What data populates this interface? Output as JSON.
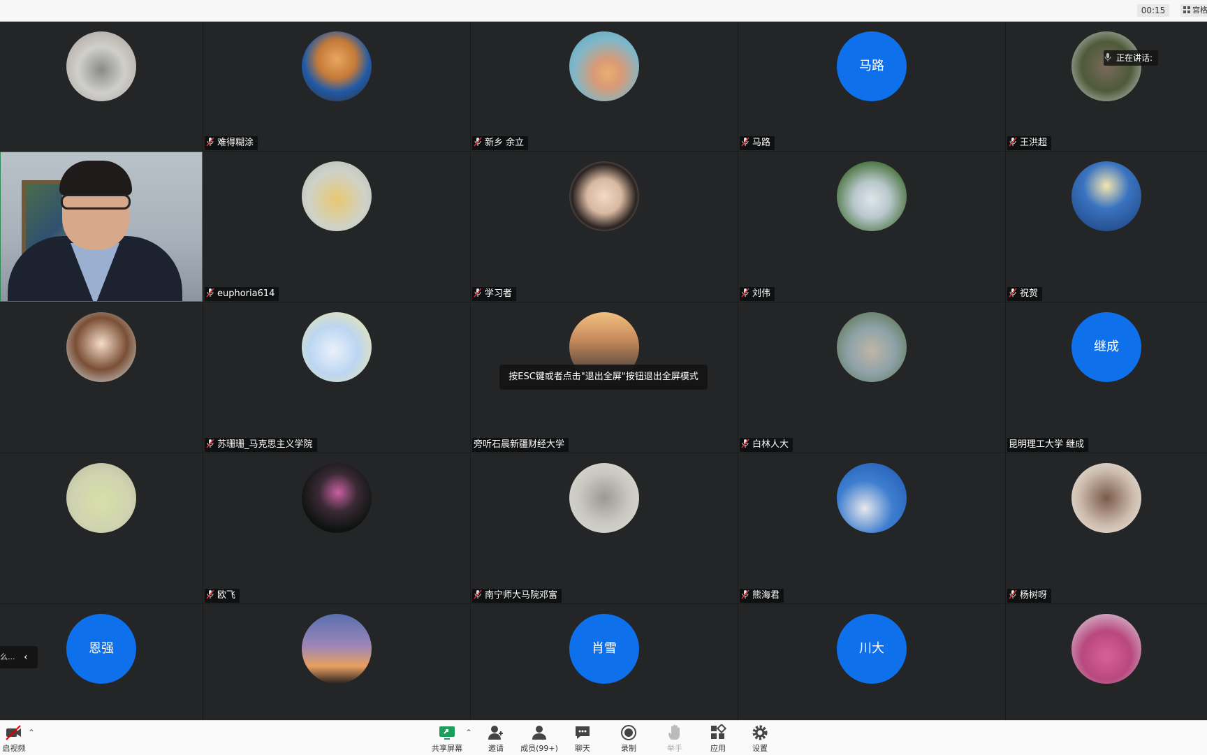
{
  "topbar": {
    "timer": "00:15",
    "view_label": "宫格"
  },
  "speaking": {
    "label": "正在讲话:"
  },
  "toast": {
    "text": "按ESC键或者点击\"退出全屏\"按钮退出全屏模式"
  },
  "sidetab": {
    "text": "么..."
  },
  "colors": {
    "avatar_blue": "#0e71eb",
    "tile_bg": "#232527",
    "active_border": "#2e8b57"
  },
  "tiles": [
    {
      "name": "",
      "avatar": "dog-cartoon-photo",
      "muted": false
    },
    {
      "name": "难得糊涂",
      "avatar": "pomeranian-photo",
      "muted": true
    },
    {
      "name": "新乡 余立",
      "avatar": "seaside-person-photo",
      "muted": true
    },
    {
      "name": "马路",
      "avatar_text": "马路",
      "muted": true
    },
    {
      "name": "王洪超",
      "avatar": "man-photo",
      "muted": true
    },
    {
      "name": "",
      "avatar": "live-video",
      "muted": false
    },
    {
      "name": "euphoria614",
      "avatar": "desk-photo",
      "muted": true
    },
    {
      "name": "学习者",
      "avatar": "woman-photo",
      "muted": true
    },
    {
      "name": "刘伟",
      "avatar": "eiffel-tower-photo",
      "muted": true
    },
    {
      "name": "祝贺",
      "avatar": "lighthouse-photo",
      "muted": true
    },
    {
      "name": "",
      "avatar": "anime-girl-photo",
      "muted": false
    },
    {
      "name": "苏珊珊_马克思主义学院",
      "avatar": "cartoon-cat-photo",
      "muted": true
    },
    {
      "name": "旁听石晨新疆财经大学",
      "avatar": "sunset-photo",
      "muted": false
    },
    {
      "name": "白林人大",
      "avatar": "road-photo",
      "muted": true
    },
    {
      "name": "昆明理工大学 继成",
      "avatar_text": "继成",
      "muted": false
    },
    {
      "name": "",
      "avatar": "umbrella-girl-photo",
      "muted": false
    },
    {
      "name": "欧飞",
      "avatar": "lotus-photo",
      "muted": true
    },
    {
      "name": "南宁师大马院邓富",
      "avatar": "landscape-painting-photo",
      "muted": true
    },
    {
      "name": "熊海君",
      "avatar": "building-photo",
      "muted": true
    },
    {
      "name": "杨树呀",
      "avatar": "sketch-face-photo",
      "muted": true
    },
    {
      "name": "",
      "avatar_text": "恩强",
      "muted": false
    },
    {
      "name": "",
      "avatar": "sunset-clouds-photo",
      "muted": false
    },
    {
      "name": "",
      "avatar_text": "肖雪",
      "muted": false
    },
    {
      "name": "",
      "avatar_text": "川大",
      "muted": false
    },
    {
      "name": "",
      "avatar": "pink-flowers-photo",
      "muted": false
    }
  ],
  "toolbar": {
    "video": "启视频",
    "share": "共享屏幕",
    "invite": "邀请",
    "members": "成员(99+)",
    "chat": "聊天",
    "record": "录制",
    "raise_hand": "举手",
    "apps": "应用",
    "settings": "设置"
  }
}
